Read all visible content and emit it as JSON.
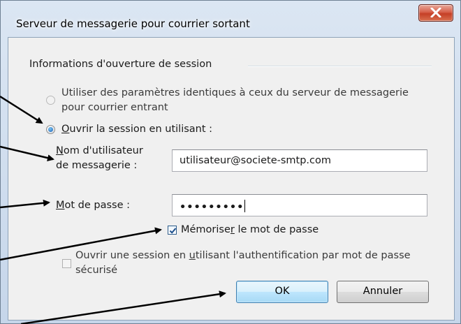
{
  "window": {
    "title": "Serveur de messagerie pour courrier sortant"
  },
  "group": {
    "title": "Informations d'ouverture de session"
  },
  "option_same_settings": {
    "line1": "Utiliser des paramètres identiques à ceux du serveur de messagerie",
    "line2": "pour courrier entrant",
    "selected": false
  },
  "option_login_using": {
    "label_accel": "O",
    "label_rest": "uvrir la session en utilisant :",
    "selected": true
  },
  "username": {
    "label_accel": "N",
    "label_rest1": "om d'utilisateur",
    "label_line2": "de messagerie :",
    "value": "utilisateur@societe-smtp.com"
  },
  "password": {
    "label_accel": "M",
    "label_rest": "ot de passe :",
    "value": "•••••••••"
  },
  "remember_password": {
    "label_pre": "Mémorise",
    "label_accel": "r",
    "label_post": " le mot de passe",
    "checked": true
  },
  "spa": {
    "line1_pre": "Ouvrir une session en ",
    "line1_accel": "u",
    "line1_post": "tilisant l'authentification par mot de passe",
    "line2": "sécurisé",
    "checked": false
  },
  "buttons": {
    "ok": "OK",
    "cancel": "Annuler"
  },
  "icons": {
    "close": "close-icon",
    "checkmark": "checkmark-icon",
    "arrow": "arrow-icon"
  },
  "colors": {
    "close_button": "#c53f26",
    "title_gradient": "#c6d6ea",
    "default_button": "#3c7fb1"
  }
}
